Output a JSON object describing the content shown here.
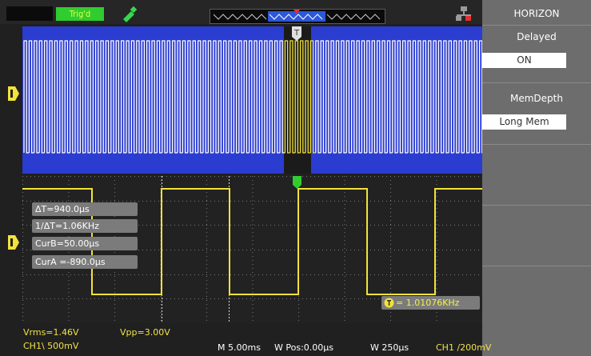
{
  "status": {
    "trigger_label": "Trig'd"
  },
  "menu": {
    "header": "HORIZON",
    "delayed_label": "Delayed",
    "delayed_value": "ON",
    "memdepth_label": "MemDepth",
    "memdepth_value": "Long Mem"
  },
  "readouts": {
    "delta_t": "ΔT=940.0μs",
    "inv_delta_t": "1/ΔT=1.06KHz",
    "cur_b": "CurB=50.00μs",
    "cur_a": "CurA =-890.0μs",
    "frequency": "= 1.01076KHz"
  },
  "measurements": {
    "vrms": "Vrms=1.46V",
    "vpp": "Vpp=3.00V",
    "ch1_scale": "CH1\\ 500mV"
  },
  "timebase": {
    "main": "M 5.00ms",
    "wpos": "W Pos:0.00μs",
    "window": "W 250μs",
    "trigger": "CH1 /200mV"
  },
  "markers": {
    "trigger": "T"
  },
  "colors": {
    "trace": "#f2e23a",
    "window_bg": "#2b3cd0",
    "menu_bg": "#6d6d6d",
    "screen_bg": "#202020"
  }
}
